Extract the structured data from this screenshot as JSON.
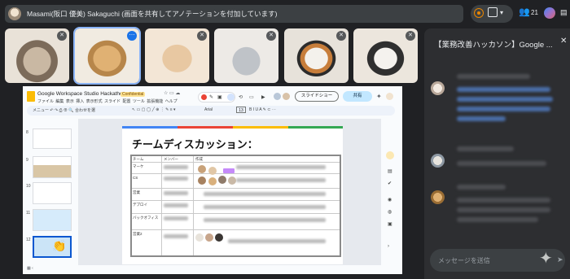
{
  "topbar": {
    "presenter_text": "Masami(阪口 優美) Sakaguchi (画面を共有してアノテーションを付加しています)",
    "people_count": "21",
    "icons": {
      "record": "record-icon",
      "share": "share-screen-icon",
      "people": "people-icon",
      "gemini": "gemini-icon",
      "tray": "tray-icon"
    }
  },
  "tiles": [
    {
      "animal": "tabby kitten plush",
      "mic": "muted"
    },
    {
      "animal": "golden retriever puppy plush",
      "mic": "speaking"
    },
    {
      "animal": "hamster plush",
      "mic": "muted"
    },
    {
      "animal": "bunny plush",
      "mic": "muted"
    },
    {
      "animal": "calico kitten plush",
      "mic": "muted"
    },
    {
      "animal": "french bulldog plush",
      "mic": "muted"
    }
  ],
  "slides": {
    "doc_title": "Google Workspace Studio Hackathon",
    "badge": "Confidential",
    "menu": [
      "ファイル",
      "編集",
      "表示",
      "挿入",
      "表示形式",
      "スライド",
      "配置",
      "ツール",
      "拡張機能",
      "ヘルプ"
    ],
    "toolbar_left": "メニュー  ↶ ↷  ⎙  ⊕  🔍  合わせを選",
    "font_name": "Arial",
    "font_size": "13",
    "slideshow_label": "スライドショー",
    "share_label": "共有",
    "slide_numbers": [
      "8",
      "9",
      "10",
      "11",
      "12"
    ],
    "slide_heading": "チームディスカッション：",
    "table": {
      "headers": [
        "チーム",
        "メンバー",
        "作成"
      ],
      "rows": [
        "マーケ",
        "CS",
        "営業",
        "デプロイ",
        "バックオフィス",
        "営業2"
      ]
    }
  },
  "chat": {
    "title": "【業務改善ハッカソン】Google ...",
    "input_placeholder": "メッセージを送信"
  }
}
